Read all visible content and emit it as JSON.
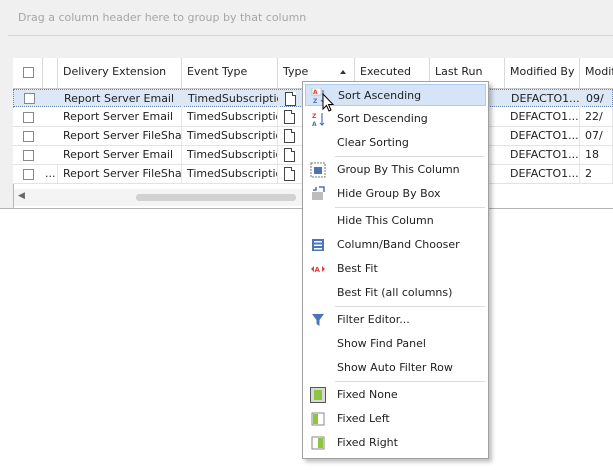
{
  "group_panel": {
    "hint": "Drag a column header here to group by that column"
  },
  "columns": [
    "Delivery Extension",
    "Event Type",
    "Type",
    "Executed",
    "Last Run",
    "Modified By",
    "Modifie"
  ],
  "rows": [
    {
      "delivery": "Report Server Email",
      "event": "TimedSubscription",
      "last_run": "...",
      "modified_by": "DEFACTO1...",
      "modified": "09/",
      "selected": true
    },
    {
      "delivery": "Report Server Email",
      "event": "TimedSubscription",
      "last_run": "...",
      "modified_by": "DEFACTO1...",
      "modified": "22/"
    },
    {
      "delivery": "Report Server FileShare",
      "event": "TimedSubscription",
      "last_run": "...",
      "modified_by": "DEFACTO1...",
      "modified": "07/"
    },
    {
      "delivery": "Report Server Email",
      "event": "TimedSubscription",
      "last_run": "...",
      "modified_by": "DEFACTO1...",
      "modified": "18"
    },
    {
      "delivery": "Report Server FileShare",
      "event": "TimedSubscription",
      "last_run": "...",
      "modified_by": "DEFACTO1...",
      "modified": "2",
      "prefix": "..."
    }
  ],
  "menu": {
    "sort_ascending": "Sort Ascending",
    "sort_descending": "Sort Descending",
    "clear_sorting": "Clear Sorting",
    "group_by_column": "Group By This Column",
    "hide_group_box": "Hide Group By Box",
    "hide_column": "Hide This Column",
    "column_chooser": "Column/Band Chooser",
    "best_fit": "Best Fit",
    "best_fit_all": "Best Fit (all columns)",
    "filter_editor": "Filter Editor...",
    "show_find_panel": "Show Find Panel",
    "show_auto_filter": "Show Auto Filter Row",
    "fixed_none": "Fixed None",
    "fixed_left": "Fixed Left",
    "fixed_right": "Fixed Right"
  },
  "colors": {
    "highlight": "#d6e4f7",
    "accent": "#4a76b8",
    "red": "#d9413a"
  }
}
